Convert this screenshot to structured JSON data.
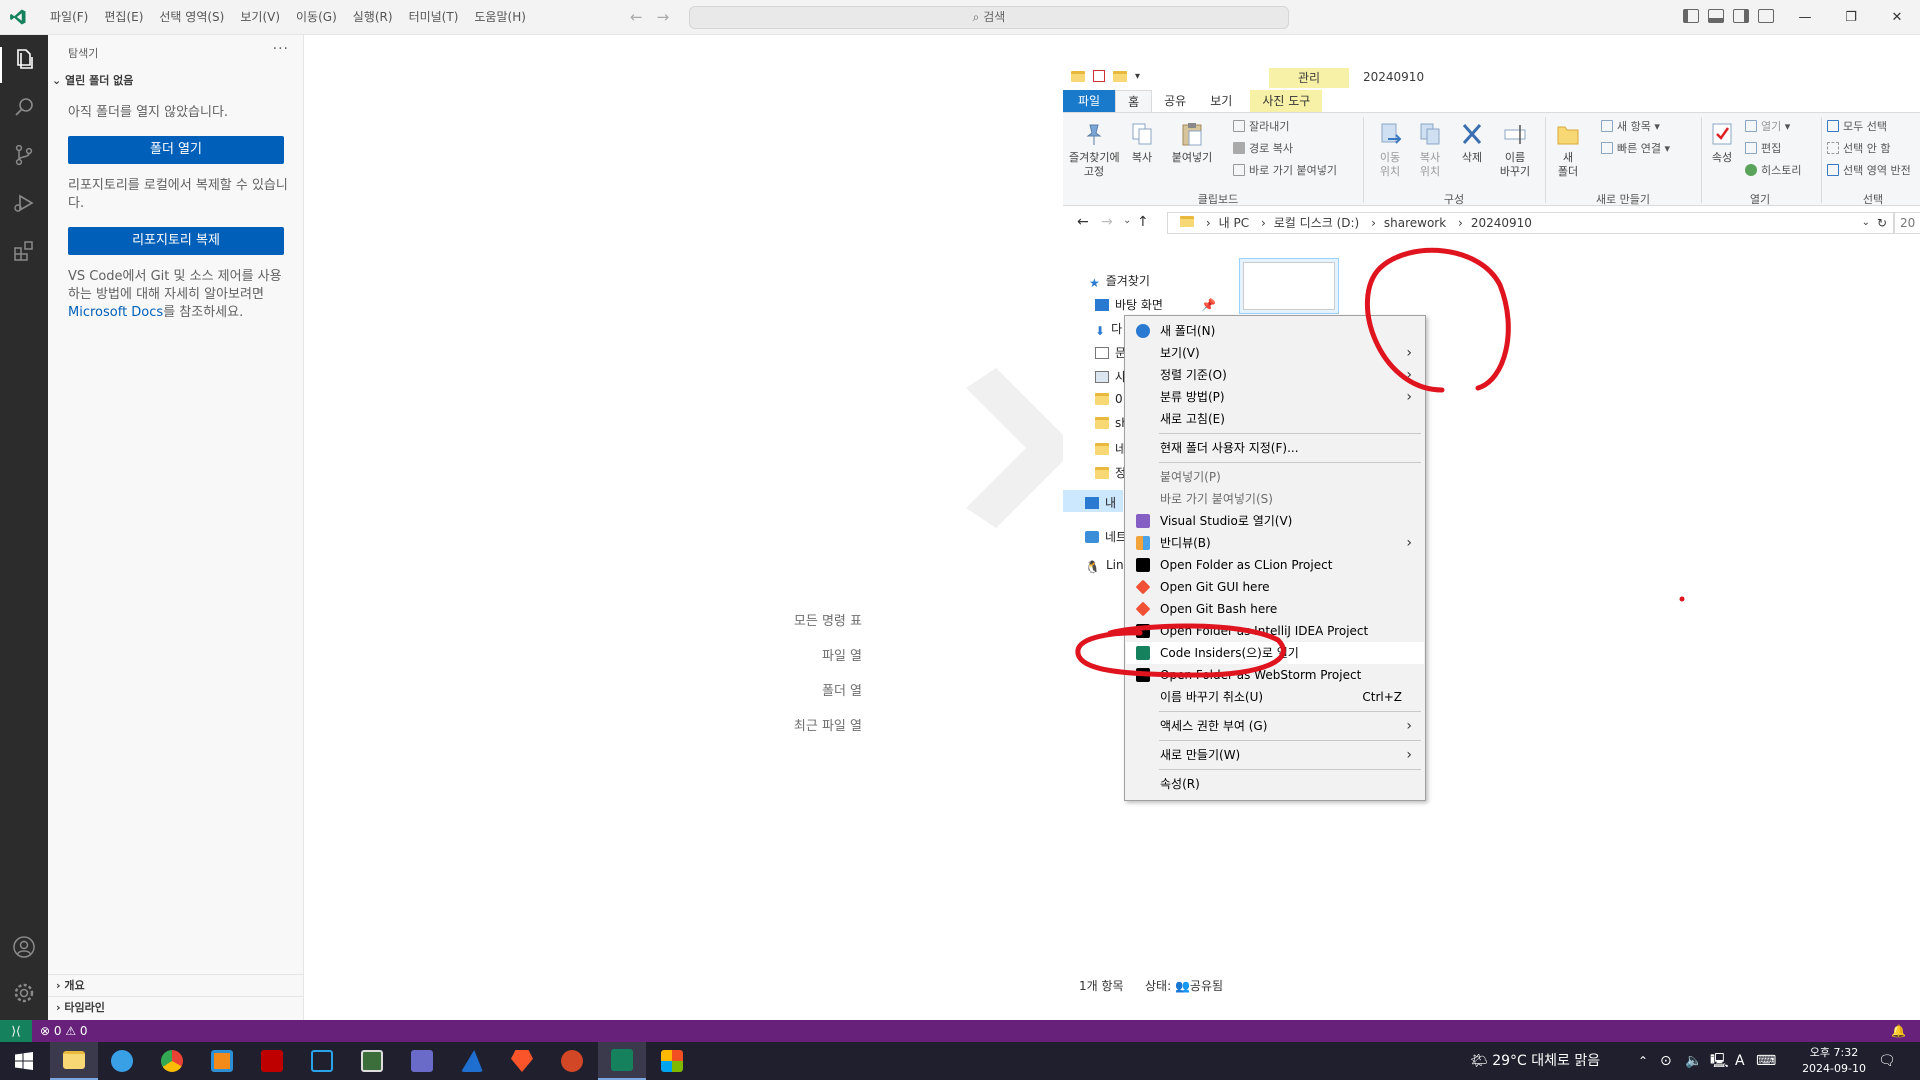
{
  "vscode": {
    "menu": [
      "파일(F)",
      "편집(E)",
      "선택 영역(S)",
      "보기(V)",
      "이동(G)",
      "실행(R)",
      "터미널(T)",
      "도움말(H)"
    ],
    "search_placeholder": "검색",
    "window_controls": [
      "—",
      "❐",
      "✕"
    ],
    "sidebar": {
      "title": "탐색기",
      "section": "열린 폴더 없음",
      "no_folder_text": "아직 폴더를 열지 않았습니다.",
      "open_folder_button": "폴더 열기",
      "clone_text": "리포지토리를 로컬에서 복제할 수 있습니다.",
      "clone_button": "리포지토리 복제",
      "git_text_before": "VS Code에서 Git 및 소스 제어를 사용하는 방법에 대해 자세히 알아보려면 ",
      "git_link": "Microsoft Docs",
      "git_text_after": "를 참조하세요.",
      "outline": "개요",
      "timeline": "타임라인"
    },
    "editor_shortcuts": [
      "모든 명령 표",
      "파일 열",
      "폴더 열",
      "최근 파일 열"
    ],
    "statusbar": {
      "problems": "⊗ 0 ⚠ 0"
    }
  },
  "explorer": {
    "context_tab": "관리",
    "folder_title": "20240910",
    "tabs": [
      "파일",
      "홈",
      "공유",
      "보기",
      "사진 도구"
    ],
    "ribbon": {
      "pin": "즐겨찾기에\n고정",
      "copy": "복사",
      "paste": "붙여넣기",
      "cut": "잘라내기",
      "copy_path": "경로 복사",
      "paste_shortcut": "바로 가기 붙여넣기",
      "group_clipboard": "클립보드",
      "move_to": "이동\n위치",
      "copy_to": "복사\n위치",
      "delete": "삭제",
      "rename": "이름\n바꾸기",
      "group_organize": "구성",
      "new_folder": "새\n폴더",
      "new_item": "새 항목",
      "easy_access": "빠른 연결",
      "group_new": "새로 만들기",
      "properties": "속성",
      "open": "열기",
      "edit": "편집",
      "history": "히스토리",
      "group_open": "열기",
      "select_all": "모두 선택",
      "select_none": "선택 안 함",
      "invert_selection": "선택 영역 반전",
      "group_select": "선택"
    },
    "breadcrumb": [
      "내 PC",
      "로컬 디스크 (D:)",
      "sharework",
      "20240910"
    ],
    "search_stub": "20",
    "nav": {
      "quick_access": "즐겨찾기",
      "desktop": "바탕 화면",
      "items_cut": [
        "다",
        "문",
        "사",
        "0",
        "sh",
        "네",
        "정"
      ],
      "this_pc": "내",
      "network": "네트",
      "linux": "Lin"
    },
    "status_count": "1개 항목",
    "status_state": "상태:",
    "status_shared": "공유됨"
  },
  "context_menu": {
    "items": [
      {
        "label": "새 폴더(N)",
        "icon": "new-folder-icon"
      },
      {
        "label": "보기(V)",
        "submenu": true
      },
      {
        "label": "정렬 기준(O)",
        "submenu": true
      },
      {
        "label": "분류 방법(P)",
        "submenu": true
      },
      {
        "label": "새로 고침(E)"
      },
      {
        "label": "현재 폴더 사용자 지정(F)..."
      },
      {
        "label": "붙여넣기(P)",
        "disabled": true
      },
      {
        "label": "바로 가기 붙여넣기(S)",
        "disabled": true
      },
      {
        "label": "Visual Studio로 열기(V)",
        "icon": "visual-studio-icon"
      },
      {
        "label": "반디뷰(B)",
        "submenu": true,
        "icon": "bandiview-icon"
      },
      {
        "label": "Open Folder as CLion Project",
        "icon": "clion-icon"
      },
      {
        "label": "Open Git GUI here",
        "icon": "git-gui-icon"
      },
      {
        "label": "Open Git Bash here",
        "icon": "git-bash-icon"
      },
      {
        "label": "Open Folder as IntelliJ IDEA Project",
        "icon": "intellij-icon"
      },
      {
        "label": "Code Insiders(으)로 열기",
        "icon": "vscode-insiders-icon"
      },
      {
        "label": "Open Folder as WebStorm Project",
        "icon": "webstorm-icon"
      },
      {
        "label": "이름 바꾸기 취소(U)",
        "shortcut": "Ctrl+Z"
      },
      {
        "label": "액세스 권한 부여 (G)",
        "submenu": true
      },
      {
        "label": "새로 만들기(W)",
        "submenu": true
      },
      {
        "label": "속성(R)"
      }
    ]
  },
  "taskbar": {
    "weather": "29°C  대체로 맑음",
    "time": "오후 7:32",
    "date": "2024-09-10",
    "ime": "A"
  },
  "colors": {
    "accent": "#005fb8",
    "statusbar": "#68217a",
    "remote": "#16825d",
    "annotation": "#e0141e"
  }
}
